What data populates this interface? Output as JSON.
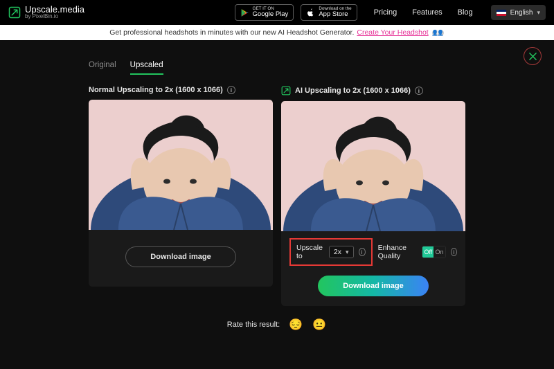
{
  "header": {
    "brand_name": "Upscale.media",
    "brand_sub": "by PixelBin.io",
    "google_play_tiny": "GET IT ON",
    "google_play_big": "Google Play",
    "app_store_tiny": "Download on the",
    "app_store_big": "App Store",
    "nav": {
      "pricing": "Pricing",
      "features": "Features",
      "blog": "Blog"
    },
    "language": "English"
  },
  "promo": {
    "text": "Get professional headshots in minutes with our new AI Headshot Generator.",
    "link": "Create Your Headshot"
  },
  "tabs": {
    "original": "Original",
    "upscaled": "Upscaled",
    "active": "Upscaled"
  },
  "panels": {
    "left": {
      "title": "Normal Upscaling to 2x (1600 x 1066)"
    },
    "right": {
      "title": "AI Upscaling to 2x (1600 x 1066)"
    }
  },
  "controls": {
    "upscale_label": "Upscale to",
    "upscale_value": "2x",
    "enhance_label": "Enhance Quality",
    "toggle_off": "Off",
    "toggle_on": "On",
    "toggle_state": "Off"
  },
  "buttons": {
    "download": "Download image"
  },
  "rating": {
    "label": "Rate this result:"
  },
  "colors": {
    "accent_green": "#22c55e",
    "highlight_red": "#e53935",
    "close_ring": "#a63a3a",
    "promo_link": "#e63197"
  }
}
